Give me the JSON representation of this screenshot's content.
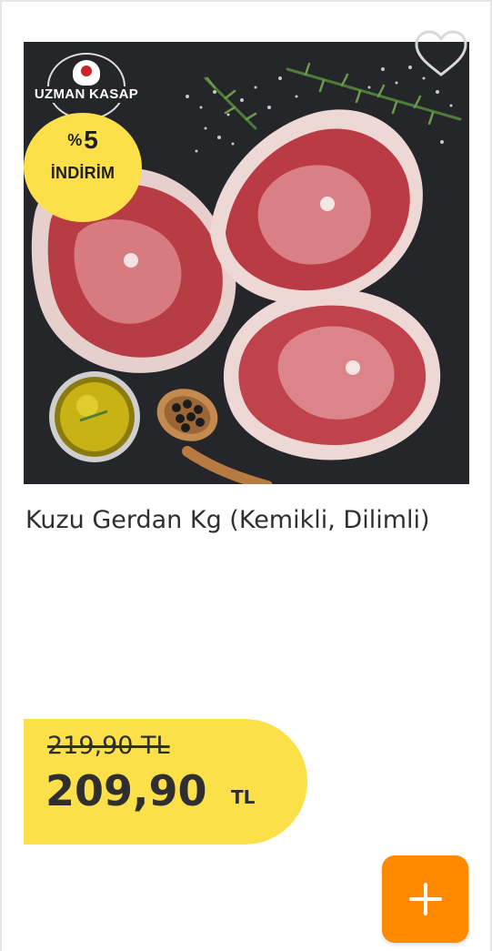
{
  "product": {
    "brand": "UZMAN KASAP",
    "discount_percent_symbol": "%",
    "discount_percent_value": "5",
    "discount_label": "İNDİRİM",
    "name": "Kuzu Gerdan Kg (Kemikli, Dilimli)",
    "old_price": "219,90 TL",
    "new_price": "209,90",
    "currency": "TL"
  },
  "icons": {
    "favorite": "heart-outline-icon",
    "add": "plus-icon"
  },
  "colors": {
    "badge_yellow": "#fbe04a",
    "add_orange": "#ff8a00",
    "text_dark": "#2f2f2f",
    "image_bg": "#25262a"
  }
}
